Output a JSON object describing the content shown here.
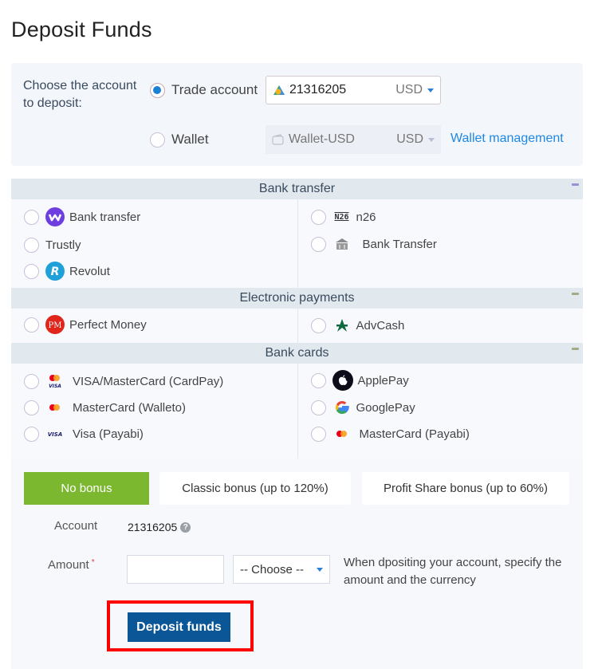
{
  "page": {
    "title": "Deposit Funds"
  },
  "account_select": {
    "label": "Choose the account to deposit:",
    "options": [
      {
        "label": "Trade account",
        "selected": true,
        "account": "21316205",
        "currency": "USD",
        "icon": "trade-account-icon"
      },
      {
        "label": "Wallet",
        "selected": false,
        "account": "Wallet-USD",
        "currency": "USD",
        "icon": "wallet-icon"
      }
    ],
    "wallet_management_link": "Wallet management"
  },
  "payment_sections": [
    {
      "title": "Bank transfer",
      "collapse_color": "#9b8fd6",
      "left": [
        {
          "label": "Bank transfer",
          "icon": "wise-w-icon"
        },
        {
          "label": "Trustly",
          "icon": ""
        },
        {
          "label": "Revolut",
          "icon": "revolut-icon"
        }
      ],
      "right": [
        {
          "label": "n26",
          "icon": "n26-icon"
        },
        {
          "label": "Bank Transfer",
          "icon": "bank-building-icon"
        }
      ]
    },
    {
      "title": "Electronic payments",
      "collapse_color": "#a3ab84",
      "left": [
        {
          "label": "Perfect Money",
          "icon": "perfect-money-icon"
        }
      ],
      "right": [
        {
          "label": "AdvCash",
          "icon": "advcash-icon"
        }
      ]
    },
    {
      "title": "Bank cards",
      "collapse_color": "#a3ab84",
      "left": [
        {
          "label": "VISA/MasterCard (CardPay)",
          "icon": "visa-mastercard-icon"
        },
        {
          "label": "MasterCard (Walleto)",
          "icon": "mastercard-icon"
        },
        {
          "label": "Visa (Payabi)",
          "icon": "visa-icon"
        }
      ],
      "right": [
        {
          "label": "ApplePay",
          "icon": "apple-icon"
        },
        {
          "label": "GooglePay",
          "icon": "google-icon"
        },
        {
          "label": "MasterCard (Payabi)",
          "icon": "mastercard-icon"
        }
      ]
    }
  ],
  "bonus": {
    "tabs": [
      {
        "label": "No bonus",
        "active": true
      },
      {
        "label": "Classic bonus (up to 120%)",
        "active": false
      },
      {
        "label": "Profit Share bonus (up to 60%)",
        "active": false
      }
    ]
  },
  "form": {
    "account_label": "Account",
    "account_value": "21316205",
    "amount_label": "Amount",
    "amount_required_mark": "*",
    "amount_value": "",
    "currency_selected": "-- Choose --",
    "hint": "When dpositing your account, specify the amount and the currency",
    "submit_label": "Deposit funds"
  },
  "colors": {
    "accent_blue": "#1e88e5",
    "bonus_active": "#7cb82f",
    "submit_button": "#0b5696",
    "highlight": "#ff0000"
  }
}
